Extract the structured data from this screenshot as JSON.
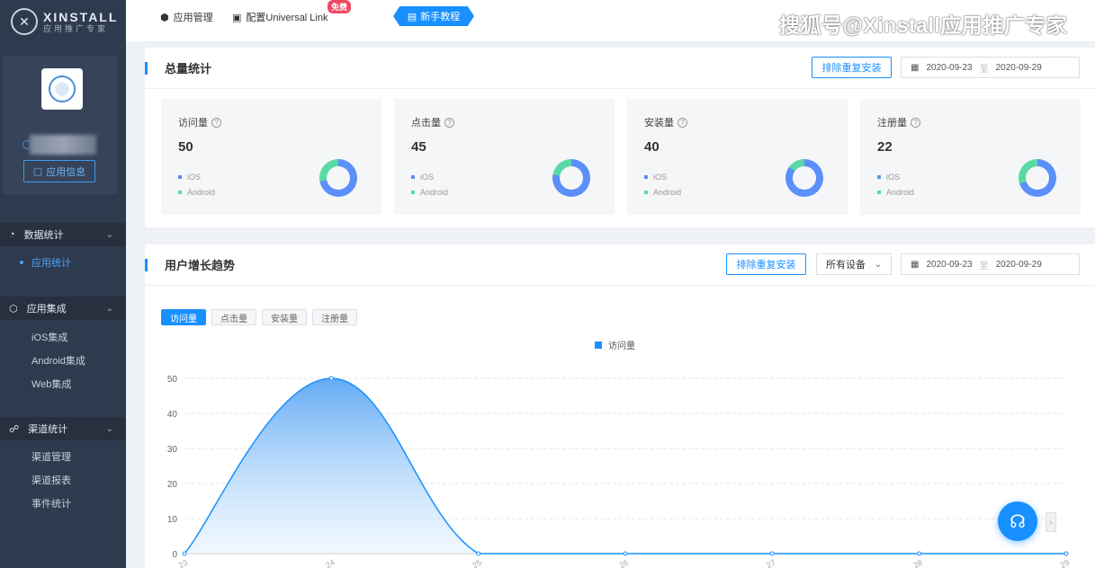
{
  "brand": {
    "name": "XINSTALL",
    "subtitle": "应用推广专家"
  },
  "app_card": {
    "info_button": "应用信息"
  },
  "sidebar": {
    "groups": [
      {
        "label": "数据统计",
        "items": [
          "应用统计"
        ]
      },
      {
        "label": "应用集成",
        "items": [
          "iOS集成",
          "Android集成",
          "Web集成"
        ]
      },
      {
        "label": "渠道统计",
        "items": [
          "渠道管理",
          "渠道报表",
          "事件统计"
        ]
      }
    ]
  },
  "topbar": {
    "app_manage": "应用管理",
    "universal_link": "配置Universal Link",
    "free_badge": "免费",
    "tutorial": "新手教程",
    "watermark": "搜狐号@Xinstall应用推广专家"
  },
  "overview": {
    "title": "总量统计",
    "dedupe_button": "排除重复安装",
    "date_start": "2020-09-23",
    "date_sep": "至",
    "date_end": "2020-09-29",
    "cards": [
      {
        "label": "访问量",
        "value": "50",
        "ios_share": 0.72
      },
      {
        "label": "点击量",
        "value": "45",
        "ios_share": 0.78
      },
      {
        "label": "安装量",
        "value": "40",
        "ios_share": 0.85
      },
      {
        "label": "注册量",
        "value": "22",
        "ios_share": 0.7
      }
    ],
    "legend_ios": "iOS",
    "legend_android": "Android",
    "colors": {
      "ios": "#5b8ff9",
      "android": "#5ad8a6"
    }
  },
  "trend": {
    "title": "用户增长趋势",
    "dedupe_button": "排除重复安装",
    "device_select": "所有设备",
    "date_start": "2020-09-23",
    "date_sep": "至",
    "date_end": "2020-09-29",
    "tabs": [
      "访问量",
      "点击量",
      "安装量",
      "注册量"
    ],
    "active_tab": 0
  },
  "chart_data": {
    "type": "area",
    "x": [
      "23",
      "24",
      "25",
      "26",
      "27",
      "28",
      "29"
    ],
    "series": [
      {
        "name": "访问量",
        "values": [
          0,
          50,
          0,
          0,
          0,
          0,
          0
        ]
      }
    ],
    "ylim": [
      0,
      50
    ],
    "yticks": [
      0,
      10,
      20,
      30,
      40,
      50
    ],
    "grid": true,
    "legend_position": "top-center",
    "color": "#1890ff"
  }
}
